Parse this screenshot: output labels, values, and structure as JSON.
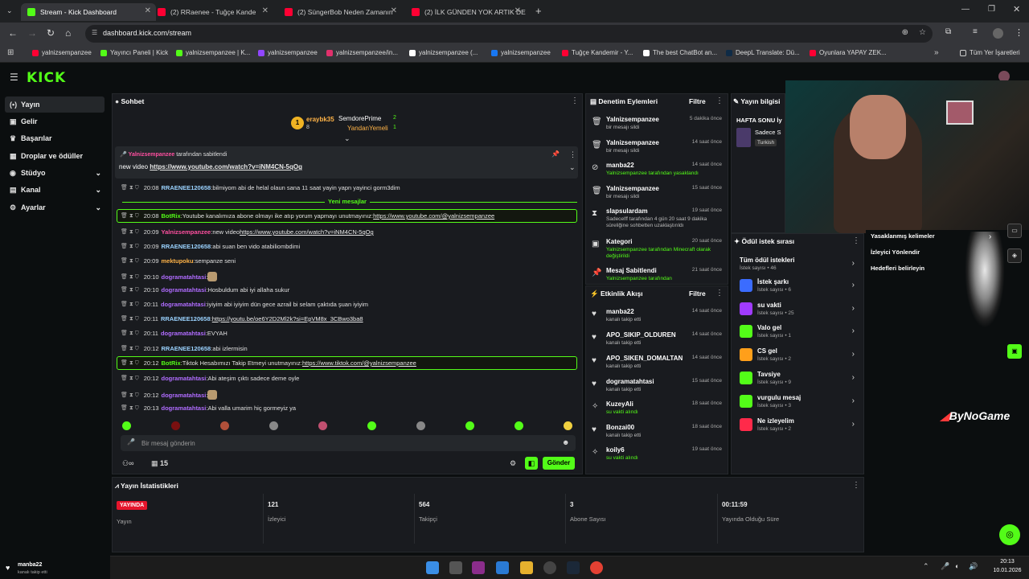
{
  "browser": {
    "tabs": [
      {
        "label": "Stream - Kick Dashboard",
        "color": "#53fc18"
      },
      {
        "label": "(2) RRaenee - Tuğçe Kande",
        "color": "#ff0033"
      },
      {
        "label": "(2) SüngerBob Neden Zamanın",
        "color": "#ff0033"
      },
      {
        "label": "(2) İLK GÜNDEN YOK ARTIK DE",
        "color": "#ff0033"
      }
    ],
    "url": "dashboard.kick.com/stream",
    "bookmarks": [
      {
        "label": "yalnizsempanzee",
        "color": "#ff0033"
      },
      {
        "label": "Yayıncı Paneli | Kick",
        "color": "#53fc18"
      },
      {
        "label": "yalnizsempanzee | K...",
        "color": "#53fc18"
      },
      {
        "label": "yalnizsempanzee",
        "color": "#9146ff"
      },
      {
        "label": "yalnizsempanzee/in...",
        "color": "#e1306c"
      },
      {
        "label": "yalnizsempanzee (...",
        "color": "#ffffff"
      },
      {
        "label": "yalnizsempanzee",
        "color": "#1877f2"
      },
      {
        "label": "Tuğçe Kandemir - Y...",
        "color": "#ff0033"
      },
      {
        "label": "The best ChatBot an...",
        "color": "#ffffff"
      },
      {
        "label": "DeepL Translate: Dü...",
        "color": "#0f2b46"
      },
      {
        "label": "Oyunlara YAPAY ZEK...",
        "color": "#ff0033"
      }
    ],
    "all_bookmarks": "Tüm Yer İşaretleri"
  },
  "sidebar": {
    "items": [
      {
        "label": "Yayın",
        "icon": "broadcast-icon",
        "active": true,
        "chevron": false
      },
      {
        "label": "Gelir",
        "icon": "wallet-icon",
        "active": false,
        "chevron": false
      },
      {
        "label": "Başarılar",
        "icon": "trophy-icon",
        "active": false,
        "chevron": false
      },
      {
        "label": "Droplar ve ödüller",
        "icon": "gift-icon",
        "active": false,
        "chevron": false
      },
      {
        "label": "Stüdyo",
        "icon": "studio-icon",
        "active": false,
        "chevron": true
      },
      {
        "label": "Kanal",
        "icon": "channel-icon",
        "active": false,
        "chevron": true
      },
      {
        "label": "Ayarlar",
        "icon": "gear-icon",
        "active": false,
        "chevron": true
      }
    ]
  },
  "chat": {
    "title": "Sohbet",
    "leaderboard": [
      {
        "rank": "1",
        "name": "eraybk35",
        "count": "8"
      },
      {
        "rank": "",
        "name": "SemdorePrime",
        "count": "2"
      },
      {
        "rank": "",
        "name": "YandanYemeli",
        "count": "1"
      }
    ],
    "pinned": {
      "by": "Yalnizsempanzee",
      "by_suffix": "tarafından sabitlendi",
      "text_prefix": "new video",
      "link": "https://www.youtube.com/watch?v=iNM4CN-5qOg"
    },
    "new_messages": "Yeni mesajlar",
    "messages": [
      {
        "time": "20:08",
        "user": "RRAENEE120658",
        "ucls": "u-blue",
        "text": "bilmiyom abi de helal olaun sana 11 saat yayin yapn yayinci gorm3dim",
        "link": "",
        "hl": false
      },
      {
        "time": "20:08",
        "user": "BotRix",
        "ucls": "u-green",
        "text": "Youtube kanalımıza abone olmayı ike atıp yorum yapmayı unutmayınız:",
        "link": "https://www.youtube.com/@yalnizsempanzee",
        "hl": true
      },
      {
        "time": "20:09",
        "user": "Yalnizsempanzee",
        "ucls": "u-pink",
        "text": "new video",
        "link": "https://www.youtube.com/watch?v=iNM4CN-5qOg",
        "hl": false
      },
      {
        "time": "20:09",
        "user": "RRAENEE120658",
        "ucls": "u-blue",
        "text": "abi suan ben vido atabiliombdimi",
        "link": "",
        "hl": false
      },
      {
        "time": "20:09",
        "user": "mektupoku",
        "ucls": "u-orange",
        "text": "sempanze seni",
        "link": "",
        "hl": false
      },
      {
        "time": "20:10",
        "user": "dogramatahtasi",
        "ucls": "u-purple",
        "text": "",
        "link": "",
        "hl": false
      },
      {
        "time": "20:10",
        "user": "dogramatahtasi",
        "ucls": "u-purple",
        "text": "Hosbuldum abi iyi allaha sukur",
        "link": "",
        "hl": false
      },
      {
        "time": "20:11",
        "user": "dogramatahtasi",
        "ucls": "u-purple",
        "text": "iyiyim abi iyiyim dün gece azrail bi selam çaktıda şuan iyiyim",
        "link": "",
        "hl": false
      },
      {
        "time": "20:11",
        "user": "RRAENEE120658",
        "ucls": "u-blue",
        "text": "",
        "link": "https://youtu.be/oe6Y2D2Ml2k?si=EpVM8x_3CBwo3ba8",
        "hl": false
      },
      {
        "time": "20:11",
        "user": "dogramatahtasi",
        "ucls": "u-purple",
        "text": "EVYAH",
        "link": "",
        "hl": false
      },
      {
        "time": "20:12",
        "user": "RRAENEE120658",
        "ucls": "u-blue",
        "text": "abi izlermisin",
        "link": "",
        "hl": false
      },
      {
        "time": "20:12",
        "user": "BotRix",
        "ucls": "u-green",
        "text": "Tiktok Hesabımızı Takip Etmeyi unutmayınız:",
        "link": "https://www.tiktok.com/@yalnizsempanzee",
        "hl": true
      },
      {
        "time": "20:12",
        "user": "dogramatahtasi",
        "ucls": "u-purple",
        "text": "Abi ateşim çıktı sadece deme oyle",
        "link": "",
        "hl": false
      },
      {
        "time": "20:12",
        "user": "dogramatahtasi",
        "ucls": "u-purple",
        "text": "",
        "link": "",
        "hl": false
      },
      {
        "time": "20:13",
        "user": "dogramatahtasi",
        "ucls": "u-purple",
        "text": "Abi valla umarim hiç gormeyiz ya",
        "link": "",
        "hl": false
      }
    ],
    "input_placeholder": "Bir mesaj gönderin",
    "viewers_icon_count": "15",
    "send_label": "Gönder"
  },
  "moderation": {
    "title": "Denetim Eylemleri",
    "filter": "Filtre",
    "rows": [
      {
        "icon": "trash-icon",
        "name": "Yalnizsempanzee",
        "desc": "bir mesajı sildi",
        "time": "5 dakika önce"
      },
      {
        "icon": "trash-icon",
        "name": "Yalnizsempanzee",
        "desc": "bir mesajı sildi",
        "time": "14 saat önce"
      },
      {
        "icon": "ban-icon",
        "name": "manba22",
        "desc": "Yalnizsempanzee tarafından yasaklandı",
        "time": "14 saat önce"
      },
      {
        "icon": "trash-icon",
        "name": "Yalnizsempanzee",
        "desc": "bir mesajı sildi",
        "time": "15 saat önce"
      },
      {
        "icon": "hourglass-icon",
        "name": "slapsulardam",
        "desc": "Sadecelff tarafından 4 gün 20 saat 9 dakika süreliğine sohbetten uzaklaştırıldı",
        "time": "19 saat önce"
      },
      {
        "icon": "category-icon",
        "name": "Kategori",
        "desc": "Yalnizsempanzee tarafından Minecraft olarak değiştirildi",
        "time": "20 saat önce"
      },
      {
        "icon": "pin-icon",
        "name": "Mesaj Sabitlendi",
        "desc": "Yalnizsempanzee tarafından",
        "time": "21 saat önce"
      }
    ]
  },
  "activity": {
    "title": "Etkinlik Akışı",
    "filter": "Filtre",
    "rows": [
      {
        "icon": "heart-icon",
        "name": "manba22",
        "desc": "kanalı takip etti",
        "time": "14 saat önce"
      },
      {
        "icon": "heart-icon",
        "name": "APO_SIKIP_OLDUREN",
        "desc": "kanalı takip etti",
        "time": "14 saat önce"
      },
      {
        "icon": "heart-icon",
        "name": "APO_SIKEN_DOMALTAN",
        "desc": "kanalı takip etti",
        "time": "14 saat önce"
      },
      {
        "icon": "heart-icon",
        "name": "dogramatahtasi",
        "desc": "kanalı takip etti",
        "time": "15 saat önce"
      },
      {
        "icon": "reward-icon",
        "name": "KuzeyAli",
        "desc": "su vakti alındı",
        "time": "18 saat önce"
      },
      {
        "icon": "heart-icon",
        "name": "Bonzai00",
        "desc": "kanalı takip etti",
        "time": "18 saat önce"
      },
      {
        "icon": "reward-icon",
        "name": "koily6",
        "desc": "su vakti alındı",
        "time": "19 saat önce"
      }
    ]
  },
  "stream_info": {
    "title": "Yayın bilgisi",
    "stream_title": "HAFTA SONU İy",
    "category": "Sadece S",
    "tag": "Turkish"
  },
  "rewards": {
    "title": "Ödül istek sırası",
    "all_label": "Tüm ödül istekleri",
    "all_count": "İstek sayısı • 46",
    "items": [
      {
        "name": "İstek şarkı",
        "count": "İstek sayısı • 6",
        "color": "#3b6cff"
      },
      {
        "name": "su vakti",
        "count": "İstek sayısı • 25",
        "color": "#a03bff"
      },
      {
        "name": "Valo gel",
        "count": "İstek sayısı • 1",
        "color": "#53fc18"
      },
      {
        "name": "CS gel",
        "count": "İstek sayısı • 2",
        "color": "#ff9f1a"
      },
      {
        "name": "Tavsiye",
        "count": "İstek sayısı • 9",
        "color": "#53fc18"
      },
      {
        "name": "vurgulu mesaj",
        "count": "İstek sayısı • 3",
        "color": "#53fc18"
      },
      {
        "name": "Ne izleyelim",
        "count": "İstek sayısı • 2",
        "color": "#ff2a4a"
      }
    ]
  },
  "quick_links": [
    "Yasaklanmış kelimeler",
    "İzleyici Yönlendir",
    "Hedefleri belirleyin"
  ],
  "stats": {
    "title": "Yayın İstatistikleri",
    "live_badge": "YAYINDA",
    "items": [
      {
        "value": "",
        "label": "Yayın"
      },
      {
        "value": "121",
        "label": "İzleyici"
      },
      {
        "value": "564",
        "label": "Takipçi"
      },
      {
        "value": "3",
        "label": "Abone Sayısı"
      },
      {
        "value": "00:11:59",
        "label": "Yayında Olduğu Süre"
      }
    ]
  },
  "watermark": "ByNoGame",
  "notification": {
    "name": "manba22",
    "desc": "kanalı takip etti"
  },
  "clock": {
    "time": "20:13",
    "date": "10.01.2026"
  }
}
